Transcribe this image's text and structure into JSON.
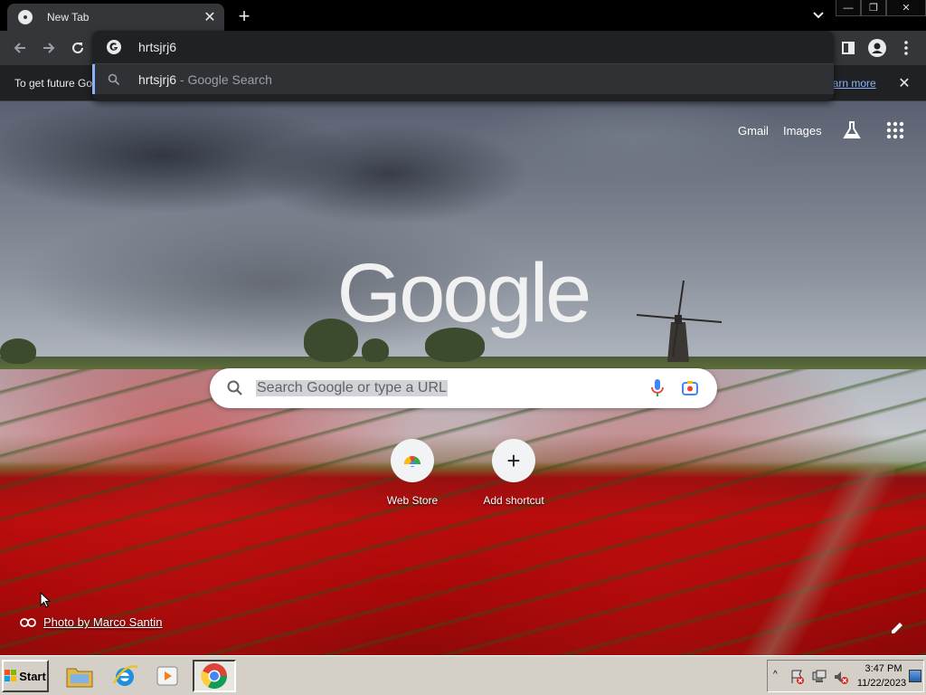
{
  "browser": {
    "tab": {
      "title": "New Tab",
      "close_glyph": "✕"
    },
    "new_tab_glyph": "+",
    "window_controls": {
      "minimize": "—",
      "restore": "❐",
      "close": "✕"
    },
    "omnibox": {
      "input_value": "hrtsjrj6",
      "suggestion": {
        "query": "hrtsjrj6",
        "source": " - Google Search"
      }
    },
    "infobar": {
      "text": "To get future Go",
      "link": "earn more",
      "close_glyph": "✕"
    }
  },
  "ntp": {
    "links": {
      "gmail": "Gmail",
      "images": "Images"
    },
    "logo": "Google",
    "search_placeholder": "Search Google or type a URL",
    "shortcuts": [
      {
        "label": "Web Store"
      },
      {
        "label": "Add shortcut",
        "glyph": "+"
      }
    ],
    "attribution": "Photo by Marco Santin"
  },
  "taskbar": {
    "start_label": "Start",
    "clock_time": "3:47 PM",
    "clock_date": "11/22/2023",
    "tray_arrow": "^"
  },
  "colors": {
    "tab_bg": "#35363a",
    "omnibox_bg": "#202124",
    "accent_link": "#8ab4f8",
    "taskbar_bg": "#d4d0c8"
  }
}
